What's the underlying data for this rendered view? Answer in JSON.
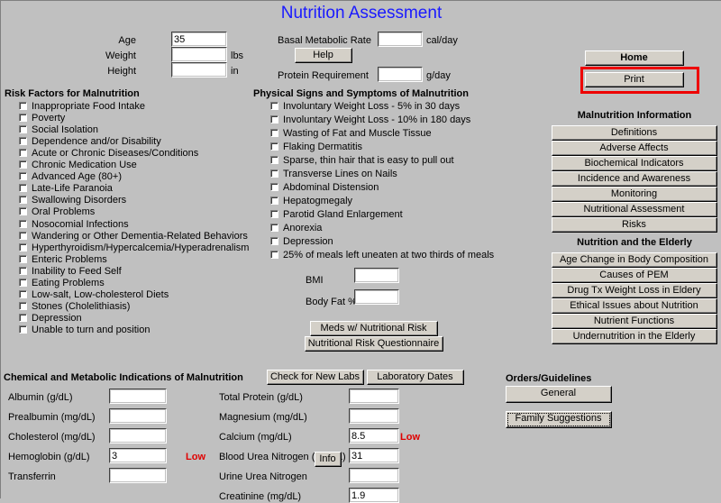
{
  "page": {
    "title": "Nutrition Assessment",
    "title_color": "#1a1aff",
    "bg_color": "#c0c0c0",
    "flag_color": "#e00000"
  },
  "vitals": {
    "age_label": "Age",
    "age_value": "35",
    "weight_label": "Weight",
    "weight_value": "",
    "weight_unit": "lbs",
    "height_label": "Height",
    "height_value": "",
    "height_unit": "in"
  },
  "metabolic": {
    "bmr_label": "Basal Metabolic Rate",
    "bmr_value": "",
    "bmr_unit": "cal/day",
    "help_label": "Help",
    "protein_label": "Protein Requirement",
    "protein_value": "",
    "protein_unit": "g/day"
  },
  "nav": {
    "home_label": "Home",
    "print_label": "Print"
  },
  "risk_factors": {
    "heading": "Risk Factors for Malnutrition",
    "items": [
      "Inappropriate Food Intake",
      "Poverty",
      "Social Isolation",
      "Dependence and/or Disability",
      "Acute or Chronic Diseases/Conditions",
      "Chronic Medication Use",
      "Advanced Age (80+)",
      "Late-Life Paranoia",
      "Swallowing Disorders",
      "Oral Problems",
      "Nosocomial Infections",
      "Wandering or Other Dementia-Related Behaviors",
      "Hyperthyroidism/Hypercalcemia/Hyperadrenalism",
      "Enteric Problems",
      "Inability to Feed Self",
      "Eating Problems",
      "Low-salt, Low-cholesterol Diets",
      "Stones (Cholelithiasis)",
      "Depression",
      "Unable to turn and position"
    ]
  },
  "physical_signs": {
    "heading": "Physical Signs and Symptoms of Malnutrition",
    "items": [
      "Involuntary Weight Loss - 5% in 30 days",
      "Involuntary Weight Loss - 10% in 180 days",
      "Wasting of Fat and Muscle Tissue",
      "Flaking Dermatitis",
      "Sparse, thin hair that is easy to pull out",
      "Transverse Lines on Nails",
      "Abdominal Distension",
      "Hepatogmegaly",
      "Parotid Gland Enlargement",
      "Anorexia",
      "Depression",
      "25% of meals left uneaten at two thirds of meals"
    ],
    "bmi_label": "BMI",
    "bmi_value": "",
    "bodyfat_label": "Body Fat %",
    "bodyfat_value": "",
    "meds_risk_label": "Meds w/ Nutritional Risk",
    "risk_questionnaire_label": "Nutritional Risk Questionnaire"
  },
  "malnutrition_info": {
    "heading": "Malnutrition Information",
    "buttons": [
      "Definitions",
      "Adverse Affects",
      "Biochemical Indicators",
      "Incidence and Awareness",
      "Monitoring",
      "Nutritional Assessment",
      "Risks"
    ]
  },
  "elderly": {
    "heading": "Nutrition and the Elderly",
    "buttons": [
      "Age Change in Body Composition",
      "Causes of PEM",
      "Drug Tx Weight Loss in Eldery",
      "Ethical Issues about Nutrition",
      "Nutrient Functions",
      "Undernutrition in the Elderly"
    ]
  },
  "labs": {
    "heading": "Chemical and Metabolic Indications of Malnutrition",
    "check_new_labs_label": "Check for New Labs",
    "laboratory_dates_label": "Laboratory Dates",
    "info_button_label": "Info",
    "left_column": [
      {
        "label": "Albumin (g/dL)",
        "value": "",
        "flag": ""
      },
      {
        "label": "Prealbumin (mg/dL)",
        "value": "",
        "flag": ""
      },
      {
        "label": "Cholesterol (mg/dL)",
        "value": "",
        "flag": ""
      },
      {
        "label": "Hemoglobin (g/dL)",
        "value": "3",
        "flag": "Low"
      },
      {
        "label": "Transferrin",
        "value": "",
        "flag": ""
      }
    ],
    "right_column": [
      {
        "label": "Total Protein (g/dL)",
        "value": "",
        "flag": ""
      },
      {
        "label": "Magnesium (mg/dL)",
        "value": "",
        "flag": ""
      },
      {
        "label": "Calcium (mg/dL)",
        "value": "8.5",
        "flag": "Low"
      },
      {
        "label": "Blood Urea Nitrogen (mg/dL)",
        "value": "31",
        "flag": ""
      },
      {
        "label": "Urine Urea Nitrogen",
        "value": "",
        "flag": ""
      },
      {
        "label": "Creatinine (mg/dL)",
        "value": "1.9",
        "flag": ""
      }
    ]
  },
  "orders": {
    "heading": "Orders/Guidelines",
    "general_label": "General",
    "family_label": "Family Suggestions"
  }
}
